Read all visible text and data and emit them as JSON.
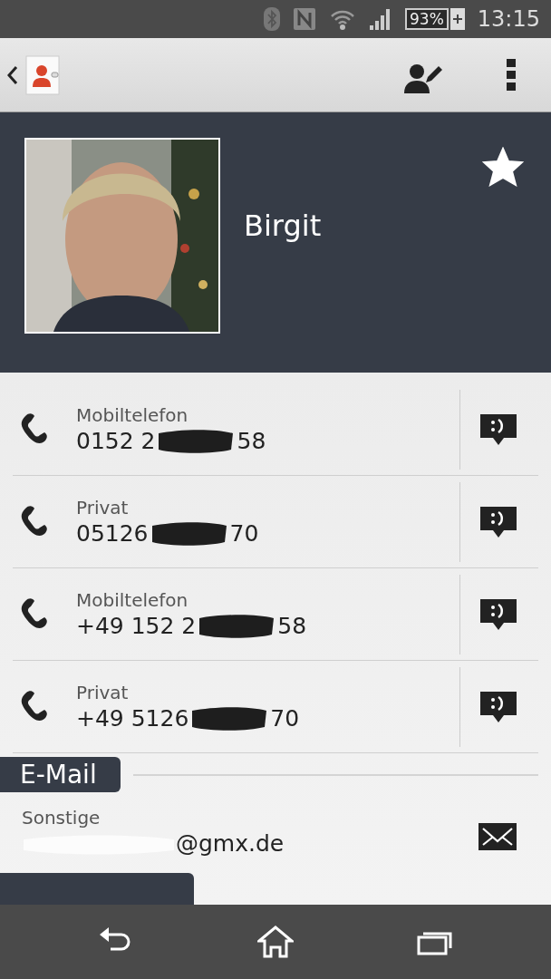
{
  "status_bar": {
    "battery": "93%",
    "time": "13:15"
  },
  "contact": {
    "name": "Birgit",
    "favorite": true
  },
  "phones": [
    {
      "label": "Mobiltelefon",
      "number_start": "0152 2",
      "number_end": "58"
    },
    {
      "label": "Privat",
      "number_start": "05126",
      "number_end": "70"
    },
    {
      "label": "Mobiltelefon",
      "number_start": "+49 152 2",
      "number_end": "58"
    },
    {
      "label": "Privat",
      "number_start": "+49 5126",
      "number_end": "70"
    }
  ],
  "email_section": {
    "title": "E-Mail",
    "entries": [
      {
        "label": "Sonstige",
        "address_end": "@gmx.de"
      }
    ]
  }
}
